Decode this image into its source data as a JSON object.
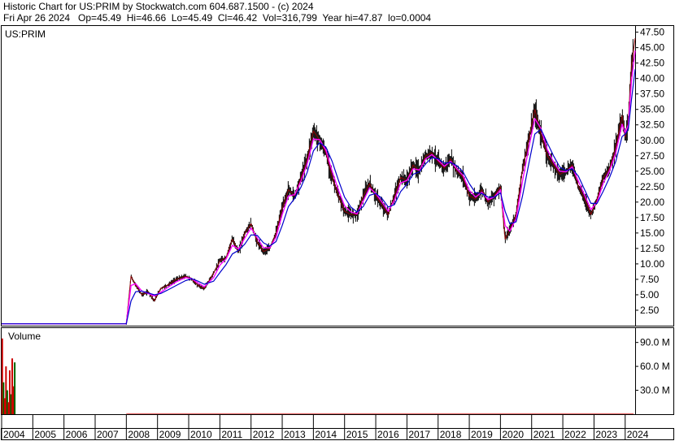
{
  "header": {
    "line1": "Historic Chart for US:PRIM by Stockwatch.com 604.687.1500 - (c) 2024",
    "line2": "Fri Apr 26 2024   Op=45.49  Hi=46.66  Lo=45.49  Cl=46.42  Vol=316,799  Year hi=47.87  lo=0.0004"
  },
  "colors": {
    "price_bar": "#000000",
    "ma_short": "#ff00ff",
    "ma_long": "#0000cc",
    "volume_bar": "#cc0000",
    "volume_bar_dark": "#006600",
    "background": "#ffffff",
    "frame": "#000000"
  },
  "chart_data": [
    {
      "type": "line",
      "panel": "price",
      "title": "US:PRIM",
      "xlabel": "",
      "ylabel": "",
      "ylim": [
        0,
        48.5
      ],
      "grid": false,
      "y_axis_side": "right",
      "y_ticks": [
        "47.50",
        "45.00",
        "42.50",
        "40.00",
        "37.50",
        "35.00",
        "32.50",
        "30.00",
        "27.50",
        "25.00",
        "22.50",
        "20.00",
        "17.50",
        "15.00",
        "12.50",
        "10.00",
        "7.50",
        "5.00",
        "2.50"
      ],
      "y_tick_values": [
        47.5,
        45,
        42.5,
        40,
        37.5,
        35,
        32.5,
        30,
        27.5,
        25,
        22.5,
        20,
        17.5,
        15,
        12.5,
        10,
        7.5,
        5,
        2.5
      ],
      "x_years": [
        "2004",
        "2005",
        "2006",
        "2007",
        "2008",
        "2009",
        "2010",
        "2011",
        "2012",
        "2013",
        "2014",
        "2015",
        "2016",
        "2017",
        "2018",
        "2019",
        "2020",
        "2021",
        "2022",
        "2023",
        "2024"
      ],
      "x": [
        2004.0,
        2008.0,
        2008.15,
        2008.3,
        2008.5,
        2008.7,
        2008.9,
        2009.1,
        2009.3,
        2009.6,
        2009.9,
        2010.1,
        2010.3,
        2010.5,
        2010.8,
        2011.0,
        2011.2,
        2011.4,
        2011.6,
        2011.8,
        2012.0,
        2012.2,
        2012.4,
        2012.6,
        2012.8,
        2013.0,
        2013.2,
        2013.4,
        2013.6,
        2013.8,
        2014.0,
        2014.2,
        2014.4,
        2014.6,
        2014.8,
        2015.0,
        2015.2,
        2015.4,
        2015.6,
        2015.8,
        2016.0,
        2016.2,
        2016.4,
        2016.6,
        2016.8,
        2017.0,
        2017.2,
        2017.4,
        2017.6,
        2017.8,
        2018.0,
        2018.2,
        2018.4,
        2018.6,
        2018.8,
        2019.0,
        2019.2,
        2019.4,
        2019.6,
        2019.8,
        2020.0,
        2020.15,
        2020.3,
        2020.5,
        2020.7,
        2020.9,
        2021.1,
        2021.3,
        2021.5,
        2021.7,
        2021.9,
        2022.1,
        2022.3,
        2022.5,
        2022.7,
        2022.9,
        2023.1,
        2023.3,
        2023.5,
        2023.7,
        2023.9,
        2024.0,
        2024.1,
        2024.2,
        2024.32
      ],
      "series": [
        {
          "name": "",
          "style": "price",
          "values": [
            0.3,
            0.3,
            8.0,
            6.5,
            5.0,
            5.5,
            4.0,
            6.0,
            6.5,
            7.5,
            8.0,
            7.5,
            6.5,
            6.0,
            8.5,
            10.5,
            11.0,
            14.0,
            12.0,
            15.0,
            16.5,
            13.5,
            12.0,
            12.5,
            15.0,
            19.0,
            22.0,
            21.0,
            24.0,
            27.0,
            31.5,
            30.0,
            28.0,
            24.0,
            21.0,
            18.5,
            18.0,
            18.0,
            21.0,
            23.0,
            21.0,
            19.5,
            18.0,
            21.0,
            24.0,
            23.5,
            26.0,
            25.0,
            27.5,
            28.0,
            26.5,
            25.5,
            27.0,
            25.0,
            24.0,
            21.0,
            20.5,
            22.0,
            20.0,
            21.0,
            22.5,
            14.0,
            15.5,
            18.0,
            25.0,
            30.0,
            35.0,
            31.0,
            27.5,
            26.0,
            24.5,
            25.0,
            26.0,
            22.5,
            20.5,
            18.0,
            20.5,
            24.0,
            25.5,
            29.0,
            34.0,
            30.5,
            33.0,
            42.0,
            46.5
          ]
        },
        {
          "name": "",
          "style": "ma_short",
          "values": [
            0.3,
            0.3,
            6.5,
            6.8,
            5.6,
            5.2,
            4.8,
            5.4,
            6.1,
            7.1,
            7.8,
            7.6,
            6.9,
            6.3,
            7.8,
            9.8,
            10.8,
            13.0,
            12.4,
            14.2,
            15.8,
            14.2,
            12.6,
            12.6,
            14.3,
            18.0,
            21.0,
            21.2,
            23.4,
            26.2,
            30.2,
            30.1,
            28.4,
            25.0,
            22.0,
            19.4,
            18.4,
            18.1,
            20.2,
            22.3,
            21.4,
            20.0,
            18.5,
            20.3,
            23.1,
            23.5,
            25.4,
            25.2,
            27.0,
            27.7,
            26.8,
            25.8,
            26.6,
            25.4,
            24.3,
            21.9,
            20.8,
            21.6,
            20.4,
            20.8,
            22.0,
            16.2,
            15.3,
            17.3,
            23.2,
            28.6,
            33.5,
            31.9,
            28.5,
            26.5,
            25.0,
            24.9,
            25.7,
            23.4,
            21.1,
            18.8,
            20.0,
            23.1,
            25.1,
            28.0,
            32.6,
            31.2,
            32.5,
            39.5,
            44.5
          ]
        },
        {
          "name": "",
          "style": "ma_long",
          "values": [
            0.3,
            0.3,
            4.0,
            5.5,
            5.6,
            5.3,
            5.0,
            5.2,
            5.7,
            6.5,
            7.3,
            7.6,
            7.2,
            6.7,
            7.2,
            8.6,
            9.9,
            11.6,
            12.2,
            13.2,
            14.7,
            14.6,
            13.4,
            12.9,
            13.6,
            16.2,
            19.3,
            20.6,
            22.4,
            24.8,
            28.3,
            29.6,
            28.9,
            26.6,
            23.6,
            20.8,
            19.2,
            18.4,
            19.3,
            21.1,
            21.4,
            20.6,
            19.2,
            19.6,
            21.7,
            22.9,
            24.5,
            24.9,
            26.2,
            27.2,
            27.0,
            26.3,
            26.4,
            25.9,
            24.9,
            23.0,
            21.5,
            21.4,
            20.8,
            20.8,
            21.5,
            18.5,
            16.5,
            16.8,
            20.8,
            26.0,
            31.0,
            31.8,
            29.6,
            27.5,
            25.7,
            25.1,
            25.4,
            24.2,
            22.0,
            19.8,
            19.8,
            21.8,
            24.0,
            26.6,
            30.6,
            31.0,
            31.8,
            36.5,
            41.5
          ]
        }
      ]
    },
    {
      "type": "bar",
      "panel": "volume",
      "title": "Volume",
      "xlabel": "",
      "ylabel": "",
      "ylim": [
        0,
        108
      ],
      "grid": false,
      "y_axis_side": "right",
      "y_ticks": [
        "90.0 M",
        "60.0 M",
        "30.0 M"
      ],
      "y_tick_values": [
        90,
        60,
        30
      ],
      "x": [
        2004.02,
        2004.06,
        2004.1,
        2004.14,
        2004.18,
        2004.22,
        2004.26,
        2004.3,
        2004.34,
        2004.38,
        2004.42
      ],
      "values": [
        95,
        40,
        20,
        60,
        30,
        15,
        55,
        25,
        70,
        35,
        65
      ],
      "baseline_volume": 1.2
    }
  ]
}
